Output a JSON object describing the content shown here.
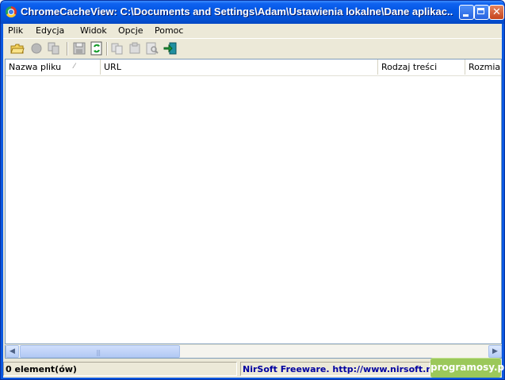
{
  "window": {
    "title": "ChromeCacheView:   C:\\Documents and Settings\\Adam\\Ustawienia lokalne\\Dane aplikac...",
    "close_glyph": "✕"
  },
  "menu": [
    "Plik",
    "Edycja",
    "Widok",
    "Opcje",
    "Pomoc"
  ],
  "toolbar": {
    "icons": [
      "open-folder-icon",
      "stop-icon",
      "copy-files-icon",
      "save-icon",
      "refresh-icon",
      "copy-icon",
      "properties-icon",
      "find-icon",
      "exit-icon"
    ]
  },
  "list": {
    "columns": [
      "Nazwa pliku",
      "URL",
      "Rodzaj treści",
      "Rozmiar"
    ],
    "sort_indicator": "⁄",
    "rows": []
  },
  "scrollbar": {
    "left_arrow": "◀",
    "right_arrow": "▶",
    "grip": "|||"
  },
  "status": {
    "items_count": "0 element(ów)",
    "credit": "NirSoft Freeware.  http://www.nirsoft.net",
    "credit_color": "#0000a0",
    "brand": "programosy.pl",
    "brand_color": "#9bc85a"
  }
}
